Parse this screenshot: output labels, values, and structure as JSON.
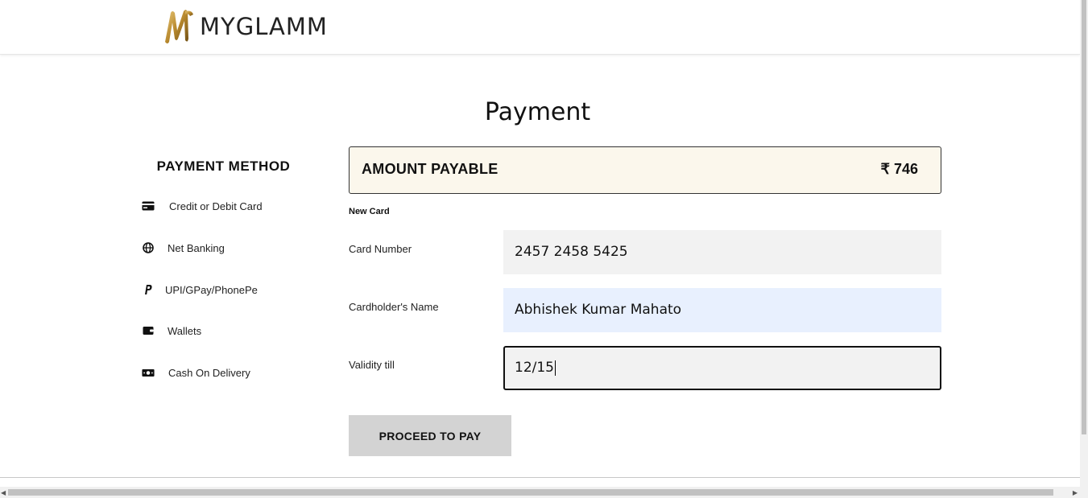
{
  "header": {
    "brand": "MYGLAMM",
    "logo_icon": "myglamm-m-logo"
  },
  "page": {
    "title": "Payment"
  },
  "payment_methods": {
    "title": "PAYMENT METHOD",
    "items": [
      {
        "label": "Credit or Debit Card",
        "icon": "credit-card-icon"
      },
      {
        "label": "Net Banking",
        "icon": "globe-icon"
      },
      {
        "label": "UPI/GPay/PhonePe",
        "icon": "paypal-icon"
      },
      {
        "label": "Wallets",
        "icon": "wallet-icon"
      },
      {
        "label": "Cash On Delivery",
        "icon": "cash-icon"
      }
    ]
  },
  "amount": {
    "label": "AMOUNT PAYABLE",
    "value": "₹ 746"
  },
  "card_form": {
    "section_label": "New Card",
    "card_number": {
      "label": "Card Number",
      "value": "2457 2458 5425"
    },
    "cardholder_name": {
      "label": "Cardholder's Name",
      "value": "Abhishek Kumar Mahato"
    },
    "validity": {
      "label": "Validity till",
      "value": "12/15"
    },
    "submit_label": "PROCEED TO PAY"
  },
  "colors": {
    "amount_bg": "#fbf7ec",
    "field_bg": "#f2f2f2",
    "autofill_bg": "#e8f0fe",
    "button_bg": "#d3d3d3",
    "logo_gold": "#b8892e"
  }
}
